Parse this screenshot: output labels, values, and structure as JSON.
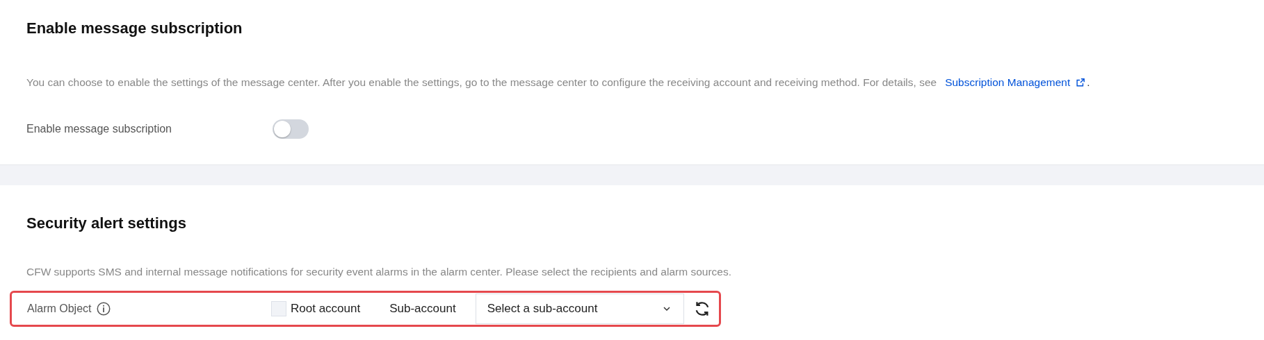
{
  "sections": [
    {
      "title": "Enable message subscription",
      "description": "You can choose to enable the settings of the message center. After you enable the settings, go to the message center to configure the receiving account and receiving method. For details, see",
      "link": {
        "label": "Subscription Management",
        "trailing": "."
      },
      "toggle": {
        "label": "Enable message subscription",
        "on": false
      }
    },
    {
      "title": "Security alert settings",
      "description": "CFW supports SMS and internal message notifications for security event alarms in the alarm center. Please select the recipients and alarm sources.",
      "alarm_object": {
        "label": "Alarm Object",
        "highlighted": true,
        "root_account": {
          "label": "Root account",
          "checked": false
        },
        "sub_account_label": "Sub-account",
        "select": {
          "placeholder": "Select a sub-account"
        }
      }
    }
  ]
}
